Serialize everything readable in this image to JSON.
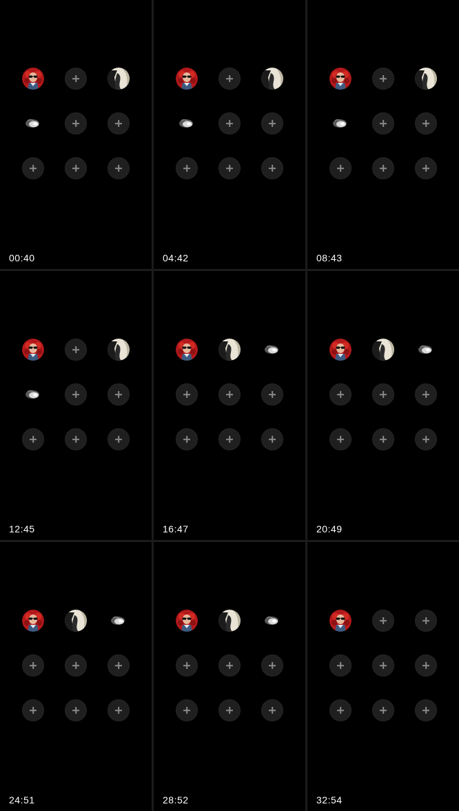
{
  "colors": {
    "background": "#000000",
    "divider": "#1c1c1c",
    "slot_fill": "#1f1f1f",
    "plus": "#8a8a8a",
    "timestamp": "#ffffff"
  },
  "slot_types": {
    "empty": "add-slot (plus-icon)",
    "a": "avatar-red-sunglasses",
    "b": "avatar-dark-hair-profile",
    "c": "avatar-white-creature"
  },
  "frames": [
    {
      "time": "00:40",
      "slots": [
        "a",
        "empty",
        "b",
        "c",
        "empty",
        "empty",
        "empty",
        "empty",
        "empty"
      ]
    },
    {
      "time": "04:42",
      "slots": [
        "a",
        "empty",
        "b",
        "c",
        "empty",
        "empty",
        "empty",
        "empty",
        "empty"
      ]
    },
    {
      "time": "08:43",
      "slots": [
        "a",
        "empty",
        "b",
        "c",
        "empty",
        "empty",
        "empty",
        "empty",
        "empty"
      ]
    },
    {
      "time": "12:45",
      "slots": [
        "a",
        "empty",
        "b",
        "c",
        "empty",
        "empty",
        "empty",
        "empty",
        "empty"
      ]
    },
    {
      "time": "16:47",
      "slots": [
        "a",
        "b",
        "c",
        "empty",
        "empty",
        "empty",
        "empty",
        "empty",
        "empty"
      ]
    },
    {
      "time": "20:49",
      "slots": [
        "a",
        "b",
        "c",
        "empty",
        "empty",
        "empty",
        "empty",
        "empty",
        "empty"
      ]
    },
    {
      "time": "24:51",
      "slots": [
        "a",
        "b",
        "c",
        "empty",
        "empty",
        "empty",
        "empty",
        "empty",
        "empty"
      ]
    },
    {
      "time": "28:52",
      "slots": [
        "a",
        "b",
        "c",
        "empty",
        "empty",
        "empty",
        "empty",
        "empty",
        "empty"
      ]
    },
    {
      "time": "32:54",
      "slots": [
        "a",
        "empty",
        "empty",
        "empty",
        "empty",
        "empty",
        "empty",
        "empty",
        "empty"
      ]
    }
  ]
}
